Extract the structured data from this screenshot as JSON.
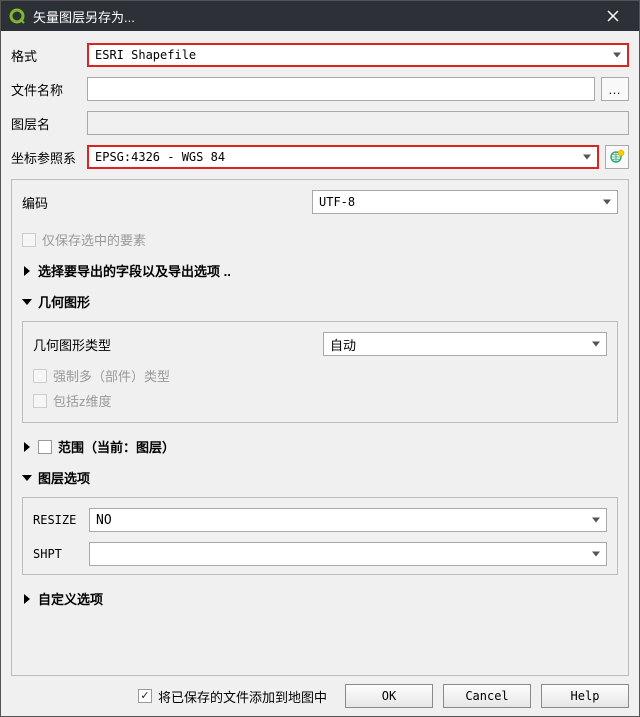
{
  "window": {
    "title": "矢量图层另存为...",
    "close_label": "×"
  },
  "form": {
    "format_label": "格式",
    "format_value": "ESRI Shapefile",
    "filename_label": "文件名称",
    "filename_value": "",
    "browse_dots": "…",
    "layername_label": "图层名",
    "layername_value": "",
    "crs_label": "坐标参照系",
    "crs_value": "EPSG:4326 - WGS 84"
  },
  "panel": {
    "encoding_label": "编码",
    "encoding_value": "UTF-8",
    "save_selected_label": "仅保存选中的要素",
    "select_fields_label": "选择要导出的字段以及导出选项 ..",
    "geometry_label": "几何图形",
    "geometry_type_label": "几何图形类型",
    "geometry_type_value": "自动",
    "force_multi_label": "强制多（部件）类型",
    "include_z_label": "包括z维度",
    "extent_label": "范围（当前：图层）",
    "layer_options_label": "图层选项",
    "resize_label": "RESIZE",
    "resize_value": "NO",
    "shpt_label": "SHPT",
    "shpt_value": "",
    "custom_options_label": "自定义选项"
  },
  "footer": {
    "add_to_map_label": "将已保存的文件添加到地图中",
    "ok": "OK",
    "cancel": "Cancel",
    "help": "Help"
  }
}
